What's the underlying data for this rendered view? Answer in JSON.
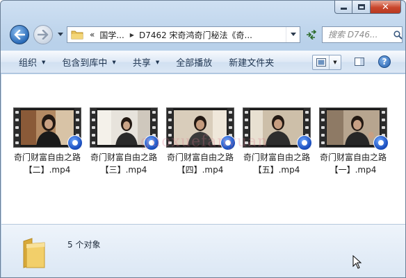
{
  "window": {
    "caption": {
      "minimize": "minimize",
      "maximize": "maximize",
      "close": "✕"
    }
  },
  "address": {
    "chevrons": "«",
    "segments": [
      "国学...",
      "D7462 宋奇鸿奇门秘法《奇..."
    ],
    "search_placeholder": "搜索 D746..."
  },
  "toolbar": {
    "items": [
      {
        "label": "组织",
        "dropdown": true
      },
      {
        "label": "包含到库中",
        "dropdown": true
      },
      {
        "label": "共享",
        "dropdown": true
      },
      {
        "label": "全部播放",
        "dropdown": false
      },
      {
        "label": "新建文件夹",
        "dropdown": false
      }
    ],
    "help": "?"
  },
  "files": [
    {
      "name_line1": "奇门财富自由之路",
      "name_line2": "【二】.mp4"
    },
    {
      "name_line1": "奇门财富自由之路",
      "name_line2": "【三】.mp4"
    },
    {
      "name_line1": "奇门财富自由之路",
      "name_line2": "【四】.mp4"
    },
    {
      "name_line1": "奇门财富自由之路",
      "name_line2": "【五】.mp4"
    },
    {
      "name_line1": "奇门财富自由之路",
      "name_line2": "【一】.mp4"
    }
  ],
  "watermark": "guoxuefanyuan",
  "details": {
    "status": "5 个对象"
  },
  "colors": {
    "accent": "#2a6bb8",
    "toolbar_text": "#1e3450",
    "badge": "#1b4fbf"
  }
}
